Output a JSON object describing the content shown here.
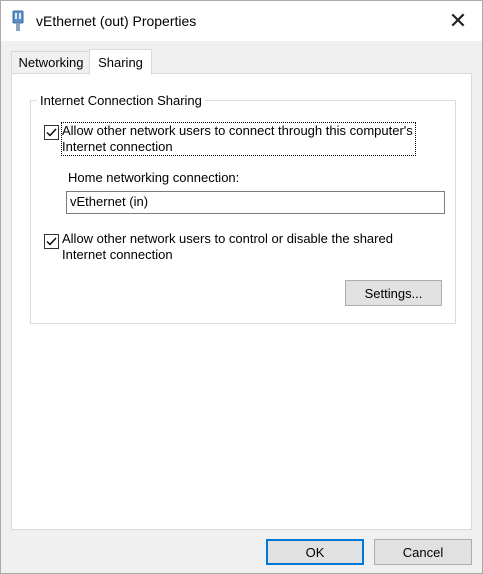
{
  "window": {
    "title": "vEthernet (out) Properties",
    "icon": "network-adapter-icon",
    "close_symbol": "✕"
  },
  "tabs": [
    {
      "label": "Networking",
      "active": false
    },
    {
      "label": "Sharing",
      "active": true
    }
  ],
  "group": {
    "title": "Internet Connection Sharing",
    "allow_connect": {
      "checked": true,
      "line1": "Allow other network users to connect through this computer's",
      "line2": "Internet connection"
    },
    "home_connection": {
      "label": "Home networking connection:",
      "value": "vEthernet (in)"
    },
    "allow_control": {
      "checked": true,
      "line1": "Allow other network users to control or disable the shared",
      "line2": "Internet connection"
    },
    "settings_button": "Settings..."
  },
  "buttons": {
    "ok": "OK",
    "cancel": "Cancel"
  },
  "colors": {
    "default_button_border": "#0078d7",
    "button_face": "#e1e1e1",
    "dialog_background": "#f0f0f0"
  }
}
